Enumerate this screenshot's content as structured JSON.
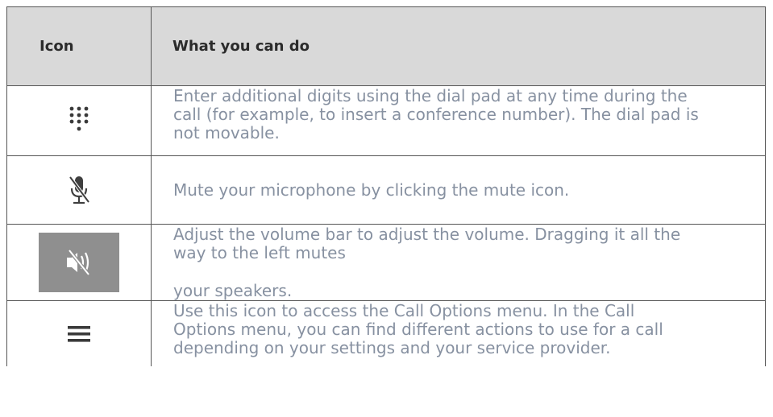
{
  "table": {
    "header": {
      "icon_col": "Icon",
      "desc_col": "What you can do"
    },
    "rows": [
      {
        "icon": "dial-pad-icon",
        "lines": [
          "Enter additional digits using the dial pad at any time during the",
          "call (for example, to insert a conference number). The dial pad is",
          "not movable."
        ]
      },
      {
        "icon": "microphone-muted-icon",
        "lines": [
          "Mute your microphone by clicking the mute icon."
        ]
      },
      {
        "icon": "speaker-muted-icon",
        "lines": [
          "Adjust the volume bar to adjust the volume. Dragging it all the",
          "way to the left mutes"
        ],
        "after_gap": "your speakers."
      },
      {
        "icon": "menu-icon",
        "lines": [
          "Use this icon to access the Call Options menu. In the Call",
          "Options menu, you can find different actions to use for a call",
          "depending on your settings and your service provider."
        ]
      }
    ]
  }
}
